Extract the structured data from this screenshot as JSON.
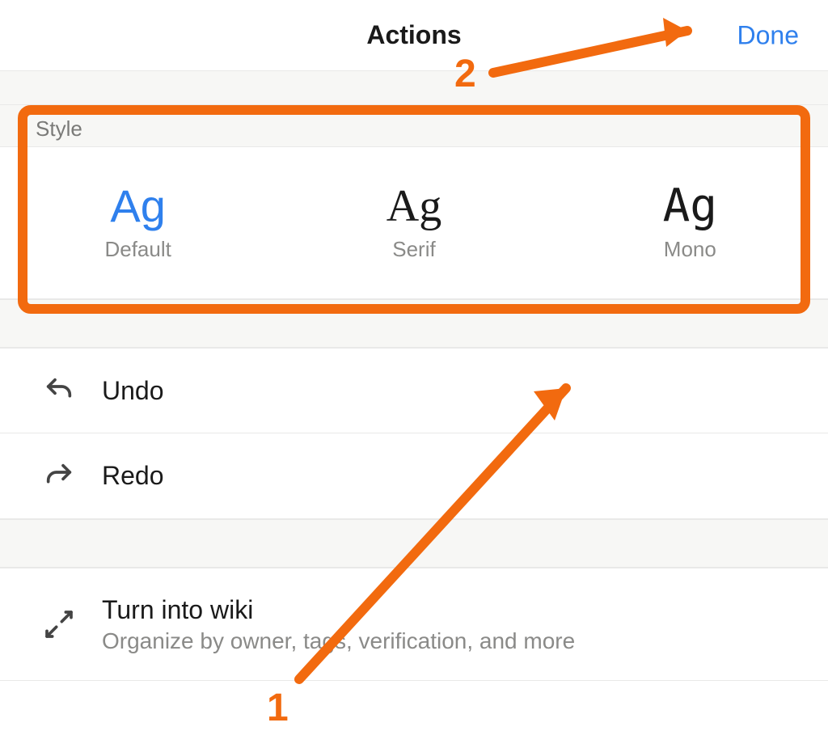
{
  "header": {
    "title": "Actions",
    "done_label": "Done"
  },
  "style_section": {
    "header_label": "Style",
    "sample_text": "Ag",
    "options": [
      {
        "label": "Default"
      },
      {
        "label": "Serif"
      },
      {
        "label": "Mono"
      }
    ]
  },
  "actions": {
    "undo_label": "Undo",
    "redo_label": "Redo",
    "wiki": {
      "title": "Turn into wiki",
      "subtitle": "Organize by owner, tags, verification, and more"
    }
  },
  "annotations": {
    "num1": "1",
    "num2": "2",
    "highlight_color": "#f26a0f"
  }
}
